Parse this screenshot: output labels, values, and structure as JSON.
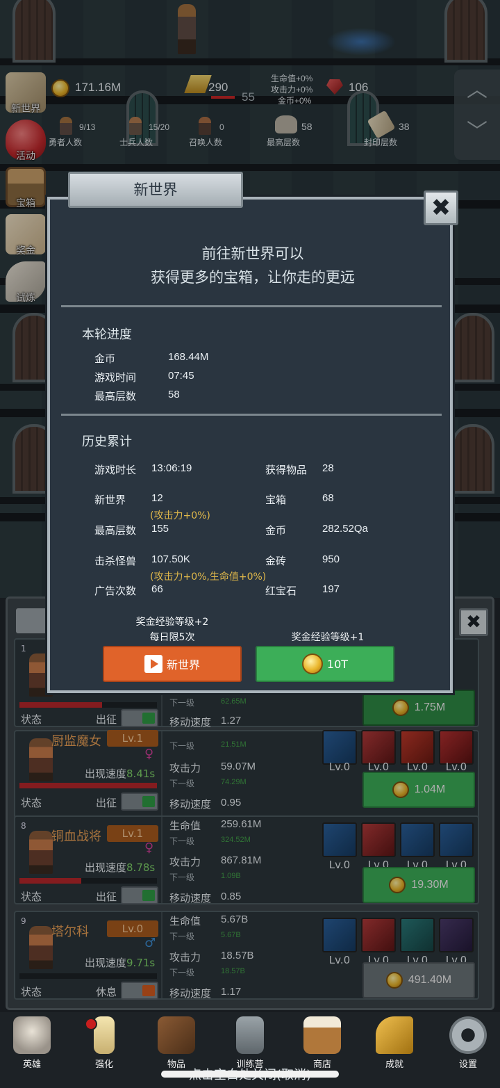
{
  "hud": {
    "gold": "171.16M",
    "battle_counter": "290",
    "floor_now": "55",
    "buffs": [
      "生命值+0%",
      "攻击力+0%",
      "金币+0%"
    ],
    "ruby": "106",
    "hero_count": "9/13",
    "hero_count_label": "勇者人数",
    "soldier_count": "15/20",
    "soldier_count_label": "士兵人数",
    "summon_count": "0",
    "summon_count_label": "召唤人数",
    "max_floor": "58",
    "max_floor_label": "最高层数",
    "seal_floor": "38",
    "seal_floor_label": "封印层数"
  },
  "side_menu": [
    {
      "label": "新世界",
      "icon": "map-scroll-icon"
    },
    {
      "label": "活动",
      "icon": "heart-icon"
    },
    {
      "label": "宝箱",
      "icon": "treasure-chest-icon"
    },
    {
      "label": "奖金",
      "icon": "envelope-icon"
    },
    {
      "label": "试炼",
      "icon": "feather-icon"
    }
  ],
  "modal": {
    "title": "新世界",
    "close": "✖",
    "intro_line1": "前往新世界可以",
    "intro_line2": "获得更多的宝箱，让你走的更远",
    "round": {
      "title": "本轮进度",
      "gold_label": "金币",
      "gold": "168.44M",
      "time_label": "游戏时间",
      "time": "07:45",
      "floor_label": "最高层数",
      "floor": "58"
    },
    "history": {
      "title": "历史累计",
      "playtime_label": "游戏时长",
      "playtime": "13:06:19",
      "items_label": "获得物品",
      "items": "28",
      "newworld_label": "新世界",
      "newworld": "12",
      "newworld_bonus": "(攻击力+0%)",
      "chests_label": "宝箱",
      "chests": "68",
      "maxfloor_label": "最高层数",
      "maxfloor": "155",
      "gold_label": "金币",
      "gold": "282.52Qa",
      "kills_label": "击杀怪兽",
      "kills": "107.50K",
      "kills_bonus": "(攻击力+0%,生命值+0%)",
      "bricks_label": "金砖",
      "bricks": "950",
      "ads_label": "广告次数",
      "ads": "66",
      "rubies_label": "红宝石",
      "rubies": "197"
    },
    "left_note1": "奖金经验等级+2",
    "left_note2": "每日限5次",
    "left_button": "新世界",
    "right_note": "奖金经验等级+1",
    "right_button": "10T"
  },
  "heroes": [
    {
      "num": "1",
      "name": "",
      "level": "",
      "state_label": "状态",
      "action": "出征",
      "hp_fraction": 0.6,
      "sub_next_label": "下一级",
      "sub_next": "62.65M",
      "move_label": "移动速度",
      "move": "1.27",
      "upgrade_cost": "1.75M",
      "toggle_on": true
    },
    {
      "num": "",
      "name": "厨监魔女",
      "level": "Lv.1",
      "gender": "♀",
      "appear_label": "出现速度",
      "appear": "8.41s",
      "hp_fraction": 1.0,
      "state_label": "状态",
      "action": "出征",
      "atk_next_label": "下一级",
      "hp_next": "21.51M",
      "atk_label": "攻击力",
      "atk": "59.07M",
      "atk_next": "74.29M",
      "move_label": "移动速度",
      "move": "0.95",
      "skills": [
        "Lv.0",
        "Lv.0",
        "Lv.0",
        "Lv.0"
      ],
      "upgrade_cost": "1.04M",
      "toggle_on": true
    },
    {
      "num": "8",
      "name": "铜血战将",
      "level": "Lv.1",
      "gender": "♀",
      "appear_label": "出现速度",
      "appear": "8.78s",
      "hp_fraction": 0.45,
      "state_label": "状态",
      "action": "出征",
      "hp_label": "生命值",
      "hp": "259.61M",
      "hp_next": "324.52M",
      "next_label": "下一级",
      "atk_label": "攻击力",
      "atk": "867.81M",
      "atk_next": "1.09B",
      "move_label": "移动速度",
      "move": "0.85",
      "skills": [
        "Lv.0",
        "Lv.0",
        "Lv.0",
        "Lv.0"
      ],
      "upgrade_cost": "19.30M",
      "toggle_on": true
    },
    {
      "num": "9",
      "name": "塔尔科",
      "level": "Lv.0",
      "gender": "♂",
      "appear_label": "出现速度",
      "appear": "9.71s",
      "hp_fraction": 0.0,
      "state_label": "状态",
      "action": "休息",
      "hp_label": "生命值",
      "hp": "5.67B",
      "hp_next": "5.67B",
      "next_label": "下一级",
      "atk_label": "攻击力",
      "atk": "18.57B",
      "atk_next": "18.57B",
      "move_label": "移动速度",
      "move": "1.17",
      "skills": [
        "Lv.0",
        "Lv.0",
        "Lv.0",
        "Lv.0"
      ],
      "upgrade_cost": "491.40M",
      "toggle_on": false
    }
  ],
  "bottom_nav": [
    {
      "label": "英雄",
      "icon": "skull-icon"
    },
    {
      "label": "强化",
      "icon": "candle-icon"
    },
    {
      "label": "物品",
      "icon": "book-icon"
    },
    {
      "label": "训练营",
      "icon": "lantern-icon"
    },
    {
      "label": "商店",
      "icon": "beer-mug-icon"
    },
    {
      "label": "成就",
      "icon": "key-icon"
    },
    {
      "label": "设置",
      "icon": "gear-icon"
    }
  ],
  "hint": "点击空白处关闭(取消)",
  "colors": {
    "accent_orange": "#e0632a",
    "accent_green": "#3cae58",
    "gold_text": "#e0b84a",
    "appear_green": "#7fd36a"
  }
}
